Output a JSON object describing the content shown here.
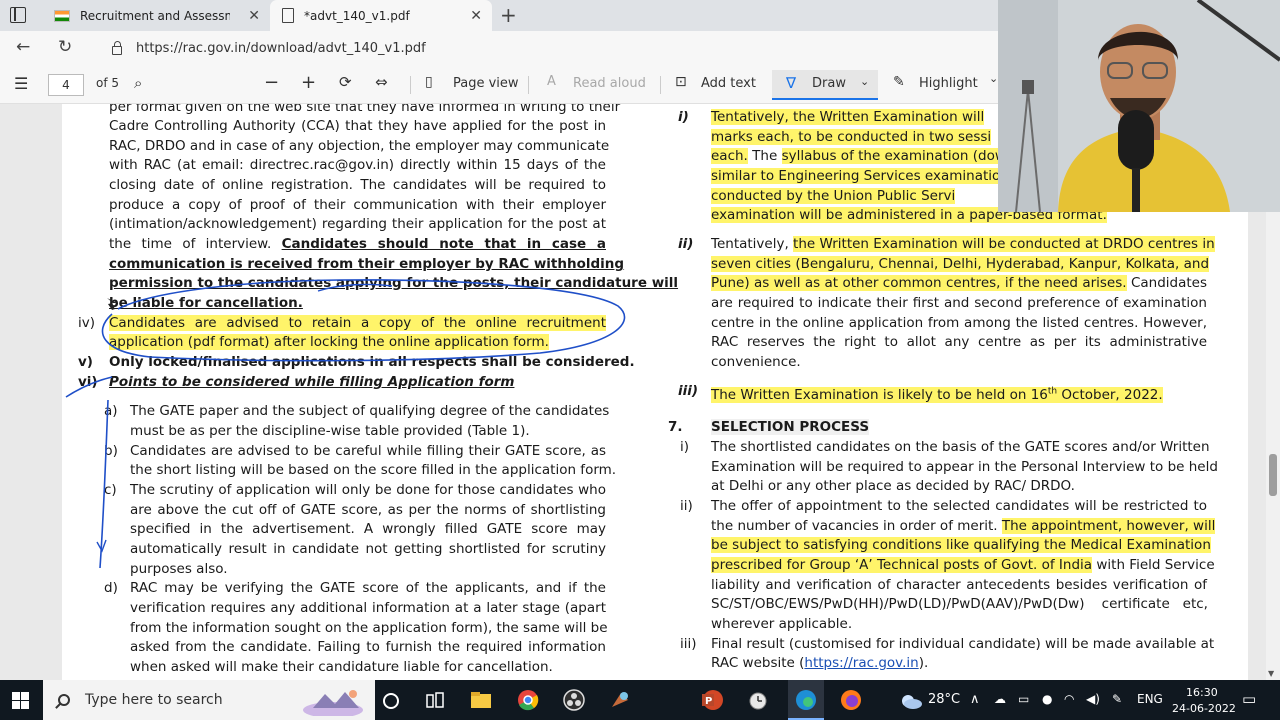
{
  "browser": {
    "tabs": [
      {
        "title": "Recruitment and Assessment Ce"
      },
      {
        "title": "*advt_140_v1.pdf"
      }
    ],
    "url": "https://rac.gov.in/download/advt_140_v1.pdf"
  },
  "pdf_toolbar": {
    "page_current": "4",
    "page_total": "of 5",
    "page_view": "Page view",
    "read_aloud": "Read aloud",
    "add_text": "Add text",
    "draw": "Draw",
    "highlight": "Highlight"
  },
  "left_column": {
    "p1": [
      "per format given on the web site that they have informed in writing to their",
      "Cadre Controlling Authority (CCA) that they have applied for the post in",
      "RAC, DRDO and in case of any objection, the employer may communicate",
      "with RAC (at email: directrec.rac@gov.in) directly within 15 days of the",
      "closing date of online registration. The candidates will be required to",
      "produce a copy of proof of their communication with their employer",
      "(intimation/acknowledgement) regarding their application for the post at"
    ],
    "p1_last_plain": "the time of interview. ",
    "p1_bold_start": "Candidates should note that in case a",
    "p1_bold_lines": [
      "communication is received from their employer by RAC withholding",
      "permission to the candidates applying for the posts, their candidature will",
      "be liable for cancellation."
    ],
    "iv_marker": "iv)",
    "iv_lines": [
      "Candidates are advised to retain a copy of the online recruitment",
      "application (pdf format) after locking the online application form."
    ],
    "v_marker": "v)",
    "v_text": "Only locked/finalised applications in all respects shall be considered.",
    "vi_marker": "vi)",
    "vi_text": "Points to be considered while filling Application form",
    "items": [
      {
        "marker": "a)",
        "lines": [
          "The GATE paper and the subject of qualifying degree of the candidates",
          "must be as per the discipline-wise table provided (Table 1)."
        ]
      },
      {
        "marker": "b)",
        "lines": [
          "Candidates are advised to be careful while filling their GATE score, as",
          "the short listing will be based on the score filled in the application form."
        ]
      },
      {
        "marker": "c)",
        "lines": [
          "The scrutiny of application will only be done for those candidates who",
          "are above the cut off of GATE score, as per the norms of shortlisting",
          "specified in the advertisement. A wrongly filled GATE score may",
          "automatically result in candidate not getting shortlisted for scrutiny",
          "purposes also."
        ]
      },
      {
        "marker": "d)",
        "lines": [
          "RAC may be verifying the GATE score of the applicants, and if the",
          "verification requires any additional information at a later stage (apart",
          "from the information sought on the application form), the same will be",
          "asked from the candidate. Failing to furnish the required information",
          "when asked will make their candidature liable for cancellation."
        ]
      }
    ]
  },
  "right_column": {
    "i_marker": "i)",
    "i_lines": [
      "Tentatively, the Written Examination will",
      "marks each, to be conducted in two sessi",
      "each.",
      "The",
      "syllabus of the examination (dow",
      "similar to Engineering Services examination",
      "conducted by the Union Public Servi",
      "examination will be administered in a paper-based format."
    ],
    "ii_marker": "ii)",
    "ii_a": "Tentatively, ",
    "ii_hl1": "the Written Examination will be conducted at DRDO centres in",
    "ii_hl2": "seven cities (Bengaluru, Chennai, Delhi, Hyderabad, Kanpur, Kolkata, and",
    "ii_hl3": "Pune) as well as at other common centres, if the need arises.",
    "ii_b": " Candidates",
    "ii_rest": [
      "are required to indicate their first and second preference of examination",
      "centre in the online application from among the listed centres. However,",
      "RAC reserves the right to allot any centre as per its administrative",
      "convenience."
    ],
    "iii_marker": "iii)",
    "iii_a": "The Written Examination is likely to be held on 16",
    "iii_sup": "th",
    "iii_b": " October, 2022.",
    "sec_num": "7.",
    "sec_title": "SELECTION PROCESS",
    "s1_marker": "i)",
    "s1_lines": [
      "The shortlisted candidates on the basis of the GATE scores and/or Written",
      "Examination will be required to appear in the Personal Interview to be held",
      "at Delhi or any other place as decided by RAC/ DRDO."
    ],
    "s2_marker": "ii)",
    "s2_line1_plain": "The offer of appointment to the selected candidates will be restricted to",
    "s2_line2_plain": "the number of vacancies in order of merit.  ",
    "s2_line2_hl": "The appointment, however, will",
    "s2_line3_hl": "be subject to satisfying conditions like qualifying the Medical Examination",
    "s2_line4_hl": "prescribed for Group ‘A’ Technical posts of Govt. of India",
    "s2_line4_plain": " with Field Service",
    "s2_rest": [
      "liability and verification of character antecedents besides verification of",
      "SC/ST/OBC/EWS/PwD(HH)/PwD(LD)/PwD(AAV)/PwD(Dw)    certificate   etc,",
      "wherever applicable."
    ],
    "s3_marker": "iii)",
    "s3_line1": "Final result (customised for individual candidate) will be made available at",
    "s3_line2_a": "RAC website (",
    "s3_link": "https://rac.gov.in",
    "s3_line2_b": ")."
  },
  "taskbar": {
    "search_placeholder": "Type here to search",
    "weather": "28°C",
    "language": "ENG",
    "time": "16:30",
    "date": "24-06-2022"
  },
  "colors": {
    "highlight": "#fff46a",
    "ink": "#1f4fc8",
    "tab_bar": "#dfe2e6",
    "taskbar": "#101820"
  }
}
